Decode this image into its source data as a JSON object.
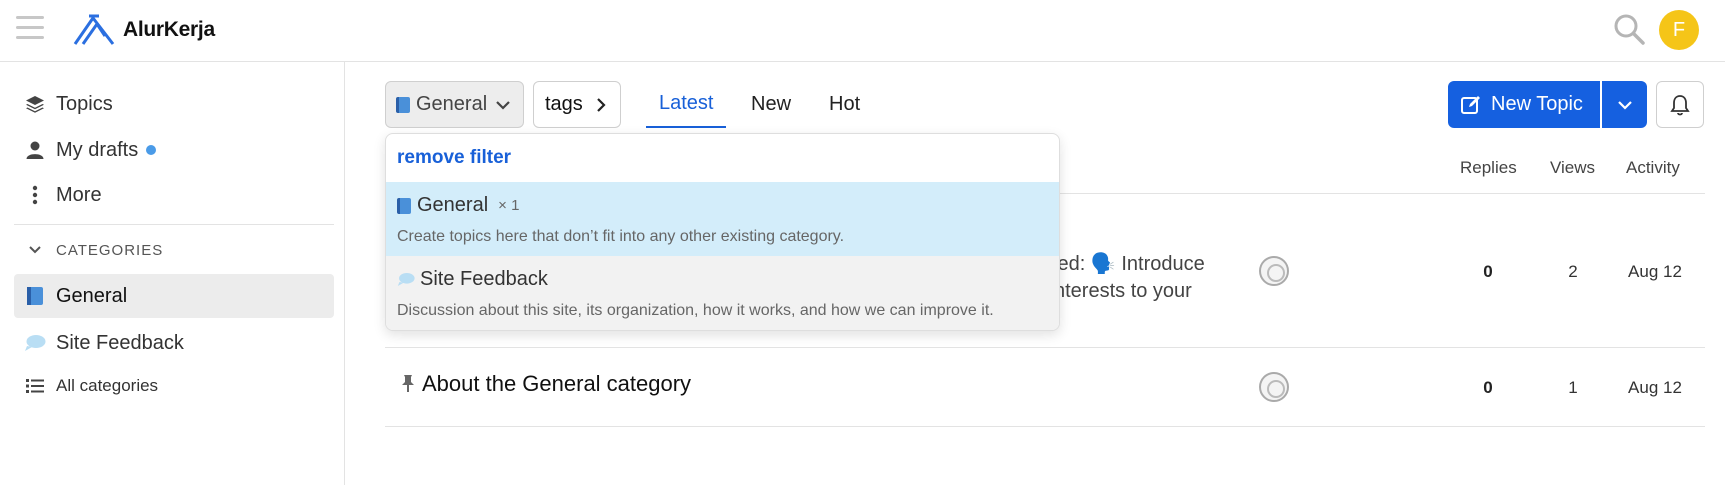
{
  "header": {
    "brand": "AlurKerja",
    "avatar_letter": "F"
  },
  "sidebar": {
    "items": [
      {
        "label": "Topics",
        "icon": "layers-icon"
      },
      {
        "label": "My drafts",
        "icon": "user-icon"
      },
      {
        "label": "More",
        "icon": "more-vertical-icon"
      }
    ],
    "categories_title": "CATEGORIES",
    "categories": [
      {
        "label": "General",
        "icon": "book-icon",
        "active": true
      },
      {
        "label": "Site Feedback",
        "icon": "speech-bubble-icon",
        "active": false
      }
    ],
    "all_categories": "All categories"
  },
  "toolbar": {
    "category_label": "General",
    "tags_label": "tags",
    "tabs": [
      {
        "label": "Latest",
        "active": true
      },
      {
        "label": "New",
        "active": false
      },
      {
        "label": "Hot",
        "active": false
      }
    ],
    "new_topic_label": "New Topic"
  },
  "columns": {
    "replies": "Replies",
    "views": "Views",
    "activity": "Activity"
  },
  "topics": [
    {
      "visible_line1": "ted: 🗣️ Introduce",
      "visible_line2": "nterests to your",
      "replies": "0",
      "views": "2",
      "activity": "Aug 12"
    },
    {
      "title": "About the General category",
      "pinned": true,
      "replies": "0",
      "views": "1",
      "activity": "Aug 12"
    }
  ],
  "dropdown": {
    "remove_filter": "remove filter",
    "options": [
      {
        "name": "General",
        "count": "× 1",
        "description": "Create topics here that don’t fit into any other existing category."
      },
      {
        "name": "Site Feedback",
        "count": "",
        "description": "Discussion about this site, its organization, how it works, and how we can improve it."
      }
    ]
  },
  "colors": {
    "accent": "#1560e0",
    "avatar": "#f5c518",
    "selected_row": "#d3edfa",
    "draft_dot": "#4a9be8"
  }
}
